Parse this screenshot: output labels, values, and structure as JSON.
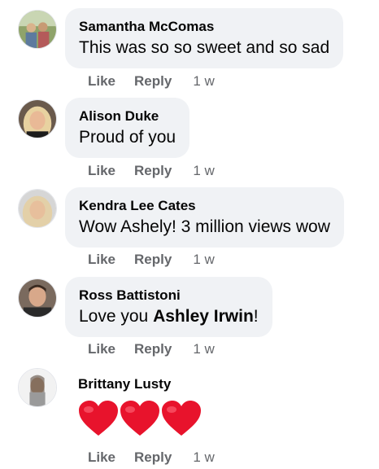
{
  "comments": [
    {
      "author": "Samantha McComas",
      "text": "This was so so sweet and so sad",
      "like": "Like",
      "reply": "Reply",
      "time": "1 w"
    },
    {
      "author": "Alison Duke",
      "text": "Proud of you",
      "like": "Like",
      "reply": "Reply",
      "time": "1 w"
    },
    {
      "author": "Kendra Lee Cates",
      "text": "Wow Ashely! 3 million views wow",
      "like": "Like",
      "reply": "Reply",
      "time": "1 w"
    },
    {
      "author": "Ross Battistoni",
      "text_prefix": "Love you ",
      "mention": "Ashley Irwin",
      "text_suffix": "!",
      "like": "Like",
      "reply": "Reply",
      "time": "1 w"
    },
    {
      "author": "Brittany Lusty",
      "content": "three heart emojis",
      "like": "Like",
      "reply": "Reply",
      "time": "1 w"
    }
  ],
  "colors": {
    "bubble": "#f0f2f5",
    "meta": "#65676b",
    "text": "#050505",
    "heart": "#e8132c"
  }
}
